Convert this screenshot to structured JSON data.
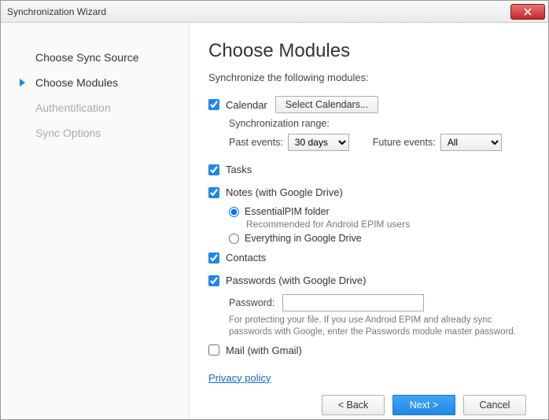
{
  "window": {
    "title": "Synchronization Wizard"
  },
  "sidebar": {
    "steps": [
      {
        "label": "Choose Sync Source",
        "state": "done"
      },
      {
        "label": "Choose Modules",
        "state": "current"
      },
      {
        "label": "Authentification",
        "state": "pending"
      },
      {
        "label": "Sync Options",
        "state": "pending"
      }
    ]
  },
  "main": {
    "heading": "Choose Modules",
    "subtitle": "Synchronize the following modules:",
    "calendar": {
      "label": "Calendar",
      "checked": true,
      "select_button": "Select Calendars...",
      "range_label": "Synchronization range:",
      "past_label": "Past events:",
      "past_value": "30 days",
      "past_options": [
        "30 days"
      ],
      "future_label": "Future events:",
      "future_value": "All",
      "future_options": [
        "All"
      ]
    },
    "tasks": {
      "label": "Tasks",
      "checked": true
    },
    "notes": {
      "label": "Notes (with Google Drive)",
      "checked": true,
      "option1": "EssentialPIM folder",
      "option1_helper": "Recommended for Android EPIM users",
      "option2": "Everything in Google Drive",
      "selected": "option1"
    },
    "contacts": {
      "label": "Contacts",
      "checked": true
    },
    "passwords": {
      "label": "Passwords (with Google Drive)",
      "checked": true,
      "pw_label": "Password:",
      "pw_value": "",
      "helper": "For protecting your file. If you use Android EPIM and already sync passwords with Google, enter the Passwords module master password."
    },
    "mail": {
      "label": "Mail (with Gmail)",
      "checked": false
    },
    "privacy_link": "Privacy policy",
    "footer": {
      "back": "< Back",
      "next": "Next >",
      "cancel": "Cancel"
    }
  }
}
